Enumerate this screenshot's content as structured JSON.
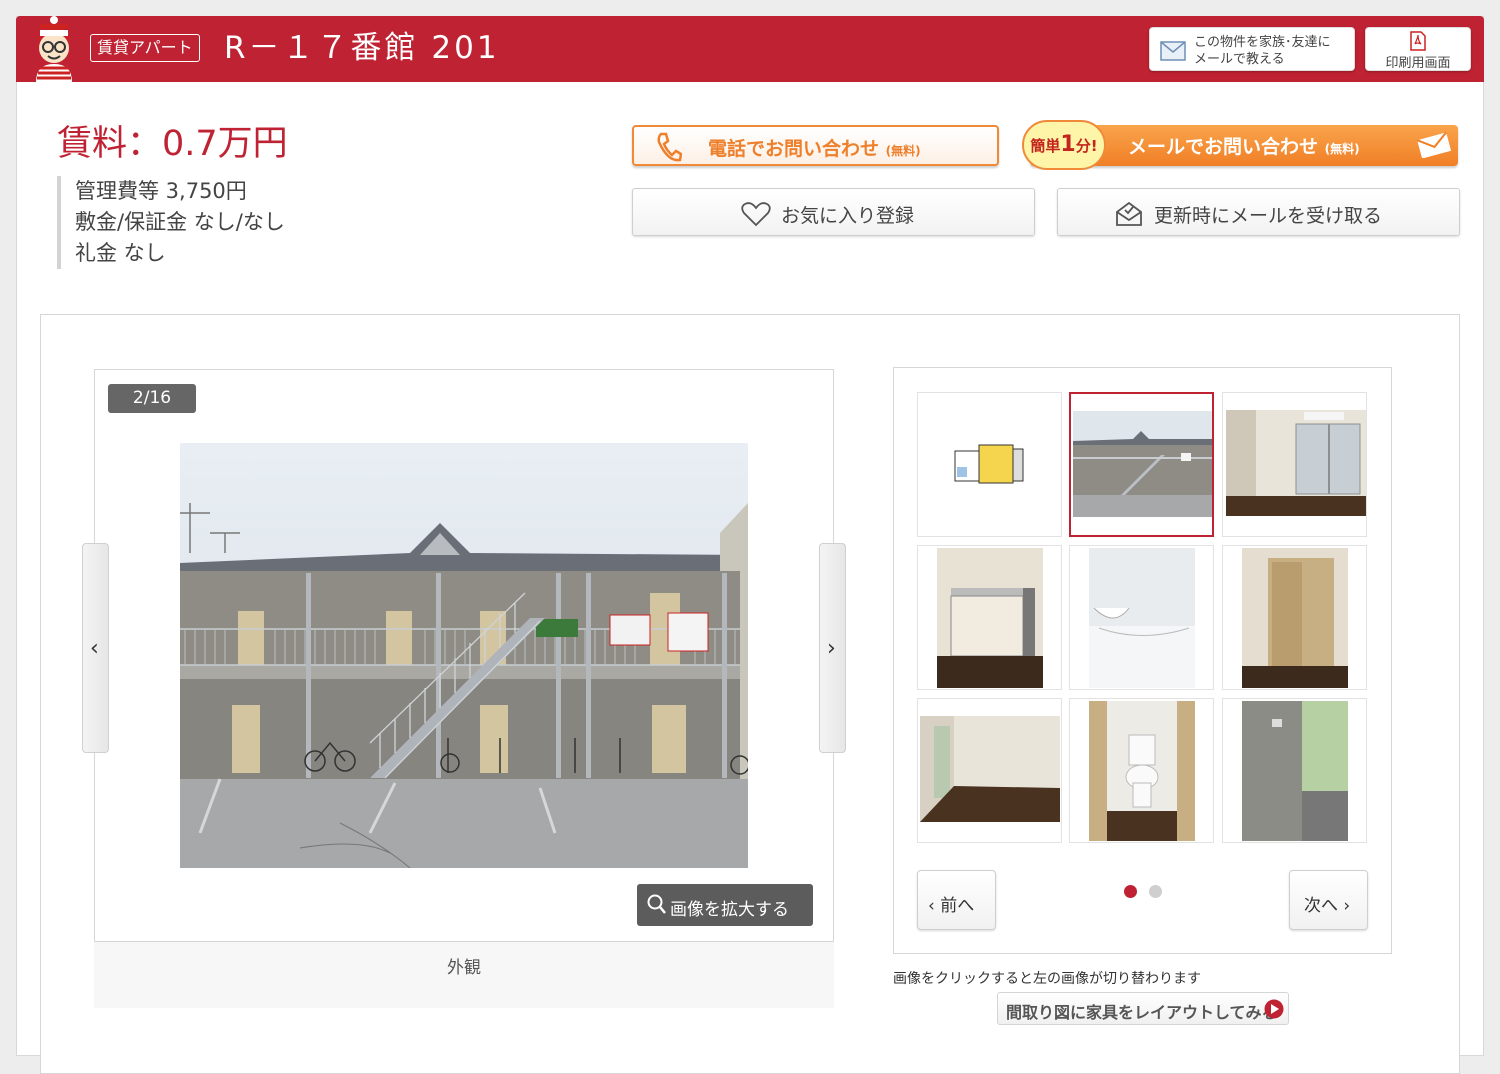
{
  "header": {
    "badge": "賃貸アパート",
    "title": "R－１７番館 201",
    "mail_friend_label_1": "この物件を家族･友達に",
    "mail_friend_label_2": "メールで教える",
    "print_label": "印刷用画面",
    "accent_color": "#bf2232"
  },
  "fees": {
    "rent": "賃料：0.7万円",
    "management": "管理費等  3,750円",
    "deposit": "敷金/保証金  なし/なし",
    "key_money": "礼金  なし"
  },
  "actions": {
    "phone_label": "電話でお問い合わせ",
    "phone_sub": "(無料)",
    "mail_label": "メールでお問い合わせ",
    "mail_sub": "(無料)",
    "quick_prefix": "簡単",
    "quick_num": "1",
    "quick_suffix": "分!",
    "favorite_label": "お気に入り登録",
    "update_mail_label": "更新時にメールを受け取る"
  },
  "gallery": {
    "counter": "2/16",
    "zoom_label": "画像を拡大する",
    "caption": "外観",
    "prev_arrow": "‹",
    "next_arrow": "›",
    "prev_label": "前へ",
    "next_label": "次へ",
    "hint": "画像をクリックすると左の画像が切り替わります",
    "layout_label": "間取り図に家具をレイアウトしてみる",
    "selected_index": 2,
    "page": 1,
    "pages": 2,
    "thumbs": [
      "floorplan-thumb",
      "exterior-thumb",
      "room-window-thumb",
      "kitchen-thumb",
      "bath-thumb",
      "closet-thumb",
      "room-thumb",
      "toilet-thumb",
      "balcony-thumb"
    ]
  }
}
